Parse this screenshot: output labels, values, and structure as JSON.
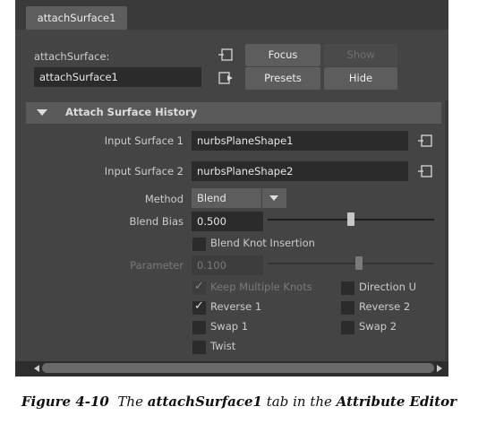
{
  "tab": {
    "label": "attachSurface1"
  },
  "node": {
    "type_label": "attachSurface:",
    "name_value": "attachSurface1"
  },
  "buttons": {
    "focus": "Focus",
    "show": "Show",
    "presets": "Presets",
    "hide": "Hide"
  },
  "section": {
    "title": "Attach Surface History"
  },
  "attrs": {
    "input_surface_1_label": "Input Surface 1",
    "input_surface_1_value": "nurbsPlaneShape1",
    "input_surface_2_label": "Input Surface 2",
    "input_surface_2_value": "nurbsPlaneShape2",
    "method_label": "Method",
    "method_value": "Blend",
    "blend_bias_label": "Blend Bias",
    "blend_bias_value": "0.500",
    "blend_bias_slider_fraction": 0.5,
    "blend_knot_insertion_label": "Blend Knot Insertion",
    "blend_knot_insertion_checked": false,
    "parameter_label": "Parameter",
    "parameter_value": "0.100",
    "parameter_slider_fraction": 0.55,
    "keep_multiple_knots_label": "Keep Multiple Knots",
    "keep_multiple_knots_checked": true,
    "direction_u_label": "Direction U",
    "direction_u_checked": false,
    "reverse1_label": "Reverse 1",
    "reverse1_checked": true,
    "reverse2_label": "Reverse 2",
    "reverse2_checked": false,
    "swap1_label": "Swap 1",
    "swap1_checked": false,
    "swap2_label": "Swap 2",
    "swap2_checked": false,
    "twist_label": "Twist",
    "twist_checked": false
  },
  "caption": {
    "figure": "Figure 4-10",
    "pre": "The",
    "tab_name": "attachSurface1",
    "mid": "tab in the",
    "editor": "Attribute Editor"
  },
  "icons": {
    "focus_icon": "input-output-icon",
    "presets_icon": "arrow-out-icon",
    "input_connect_icon": "connection-icon",
    "dropdown_icon": "triangle-down-icon",
    "section_toggle_icon": "triangle-down-icon"
  },
  "colors": {
    "panel_bg": "#444444",
    "field_bg": "#2b2b2b",
    "button_bg": "#5d5d5d",
    "section_bg": "#5a5a5a"
  }
}
